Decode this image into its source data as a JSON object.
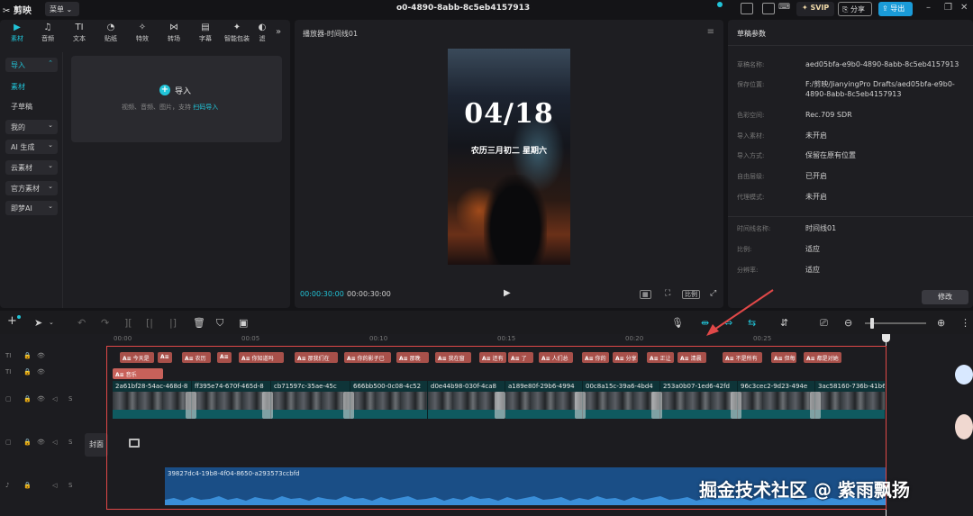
{
  "app": {
    "logo_text": "剪映",
    "menu_label": "菜单",
    "window_title": "o0-4890-8abb-8c5eb4157913",
    "svip_label": "SVIP",
    "share_label": "分享",
    "export_label": "导出"
  },
  "media_tabs": [
    {
      "label": "素材",
      "icon": "▶"
    },
    {
      "label": "音频",
      "icon": "♫"
    },
    {
      "label": "文本",
      "icon": "TI"
    },
    {
      "label": "贴纸",
      "icon": "◔"
    },
    {
      "label": "特效",
      "icon": "✧"
    },
    {
      "label": "转场",
      "icon": "⋈"
    },
    {
      "label": "字幕",
      "icon": "▤"
    },
    {
      "label": "智能包装",
      "icon": "✦"
    },
    {
      "label": "滤",
      "icon": "◐"
    }
  ],
  "sidebar": {
    "items": [
      {
        "label": "导入"
      },
      {
        "label": "素材"
      },
      {
        "label": "子草稿"
      },
      {
        "label": "我的"
      },
      {
        "label": "AI 生成"
      },
      {
        "label": "云素材"
      },
      {
        "label": "官方素材"
      },
      {
        "label": "即梦AI"
      }
    ]
  },
  "import_panel": {
    "button_label": "导入",
    "hint": "视频、音频、图片，支持",
    "hint_link": "扫码导入"
  },
  "player": {
    "title": "播放器-时间线01",
    "date_text": "04/18",
    "sub_text": "农历三月初二  星期六",
    "current_time": "00:00:30:00",
    "total_time": "00:00:30:00",
    "ctrl_ratio": "比例"
  },
  "params": {
    "title": "草稿参数",
    "rows": [
      {
        "label": "草稿名称:",
        "value": "aed05bfa-e9b0-4890-8abb-8c5eb4157913"
      },
      {
        "label": "保存位置:",
        "value": "F:/剪映/JianyingPro Drafts/aed05bfa-e9b0-4890-8abb-8c5eb4157913"
      },
      {
        "label": "色彩空间:",
        "value": "Rec.709 SDR"
      },
      {
        "label": "导入素材:",
        "value": "未开启"
      },
      {
        "label": "导入方式:",
        "value": "保留在原有位置"
      },
      {
        "label": "自由层级:",
        "value": "已开启"
      },
      {
        "label": "代理模式:",
        "value": "未开启"
      }
    ],
    "rows2": [
      {
        "label": "时间线名称:",
        "value": "时间线01"
      },
      {
        "label": "比例:",
        "value": "适应"
      },
      {
        "label": "分辨率:",
        "value": "适应"
      }
    ],
    "modify_label": "修改"
  },
  "ruler": [
    "00:00",
    "00:05",
    "00:10",
    "00:15",
    "00:20",
    "00:25"
  ],
  "text_clips_row1": [
    "今天是",
    "",
    "农历",
    "",
    "你知道吗",
    "那我们在",
    "你的影子已",
    "那晚",
    "我在窗",
    "还有",
    "了",
    "人们总",
    "你的",
    "分享",
    "正让",
    "清晨",
    "不是所有",
    "但每",
    "都是对她"
  ],
  "text_clip_row2": "音乐",
  "video_clips": [
    "2a61bf28-54ac-468d-8",
    "ff395e74-670f-465d-8",
    "cb71597c-35ae-45c",
    "666bb500-0c08-4c52",
    "d0e44b98-030f-4ca8",
    "a189e80f-29b6-4994",
    "00c8a15c-39a6-4bd4",
    "253a0b07-1ed6-42fd",
    "96c3cec2-9d23-494e",
    "3ac58160-736b-41b6"
  ],
  "cover_label": "封面",
  "audio_clip": "39827dc4-19b8-4f04-8650-a293573ccbfd",
  "watermark": "掘金技术社区 @ 紫雨飘扬"
}
